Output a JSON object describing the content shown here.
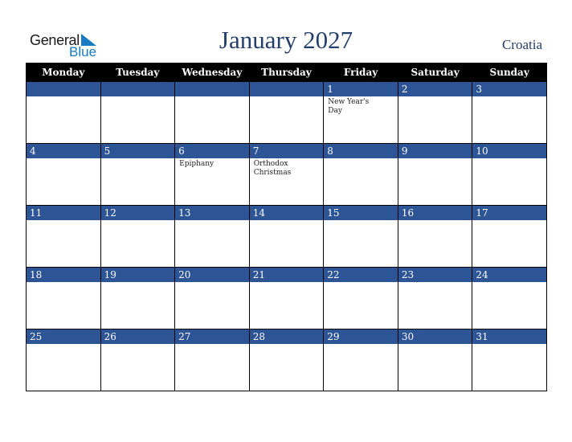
{
  "logo": {
    "word1": "General",
    "word2": "Blue",
    "icon": "triangle-flag-icon",
    "brand_color": "#1a7ac4"
  },
  "header": {
    "title": "January 2027",
    "country": "Croatia",
    "title_color": "#253f6b"
  },
  "colors": {
    "header_bg": "#000000",
    "date_bar_bg": "#2d5494",
    "date_text": "#ffffff"
  },
  "weekdays": [
    "Monday",
    "Tuesday",
    "Wednesday",
    "Thursday",
    "Friday",
    "Saturday",
    "Sunday"
  ],
  "weeks": [
    [
      {
        "day": "",
        "holiday": ""
      },
      {
        "day": "",
        "holiday": ""
      },
      {
        "day": "",
        "holiday": ""
      },
      {
        "day": "",
        "holiday": ""
      },
      {
        "day": "1",
        "holiday": "New Year's Day"
      },
      {
        "day": "2",
        "holiday": ""
      },
      {
        "day": "3",
        "holiday": ""
      }
    ],
    [
      {
        "day": "4",
        "holiday": ""
      },
      {
        "day": "5",
        "holiday": ""
      },
      {
        "day": "6",
        "holiday": "Epiphany"
      },
      {
        "day": "7",
        "holiday": "Orthodox Christmas"
      },
      {
        "day": "8",
        "holiday": ""
      },
      {
        "day": "9",
        "holiday": ""
      },
      {
        "day": "10",
        "holiday": ""
      }
    ],
    [
      {
        "day": "11",
        "holiday": ""
      },
      {
        "day": "12",
        "holiday": ""
      },
      {
        "day": "13",
        "holiday": ""
      },
      {
        "day": "14",
        "holiday": ""
      },
      {
        "day": "15",
        "holiday": ""
      },
      {
        "day": "16",
        "holiday": ""
      },
      {
        "day": "17",
        "holiday": ""
      }
    ],
    [
      {
        "day": "18",
        "holiday": ""
      },
      {
        "day": "19",
        "holiday": ""
      },
      {
        "day": "20",
        "holiday": ""
      },
      {
        "day": "21",
        "holiday": ""
      },
      {
        "day": "22",
        "holiday": ""
      },
      {
        "day": "23",
        "holiday": ""
      },
      {
        "day": "24",
        "holiday": ""
      }
    ],
    [
      {
        "day": "25",
        "holiday": ""
      },
      {
        "day": "26",
        "holiday": ""
      },
      {
        "day": "27",
        "holiday": ""
      },
      {
        "day": "28",
        "holiday": ""
      },
      {
        "day": "29",
        "holiday": ""
      },
      {
        "day": "30",
        "holiday": ""
      },
      {
        "day": "31",
        "holiday": ""
      }
    ]
  ]
}
